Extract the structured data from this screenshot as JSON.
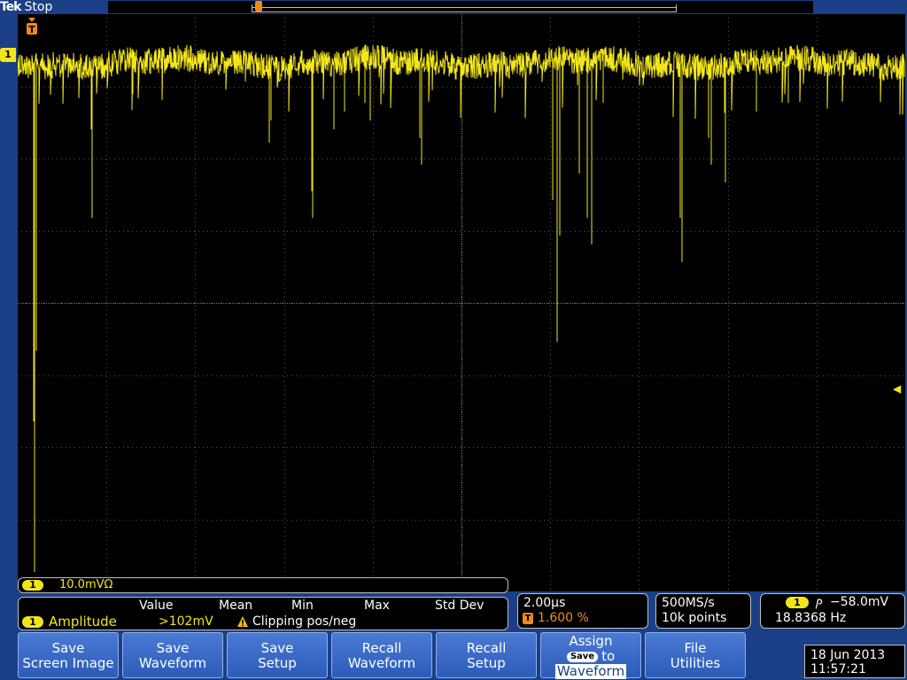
{
  "header": {
    "brand": "Tek",
    "acq_state": "Stop"
  },
  "channel": {
    "id": "1",
    "scale": "10.0mVΩ"
  },
  "measurement": {
    "columns": [
      "Value",
      "Mean",
      "Min",
      "Max",
      "Std Dev"
    ],
    "name": "Amplitude",
    "value": ">102mV",
    "warning": "Clipping pos/neg"
  },
  "timebase": {
    "scale": "2.00µs",
    "trigger_position": "1.600 %"
  },
  "acquisition": {
    "sample_rate": "500MS/s",
    "record_length": "10k points"
  },
  "trigger": {
    "edge_symbol": "ⳏ",
    "level": "−58.0mV",
    "frequency": "18.8368 Hz"
  },
  "menu": {
    "save_screen_image": [
      "Save",
      "Screen Image"
    ],
    "save_waveform": [
      "Save",
      "Waveform"
    ],
    "save_setup": [
      "Save",
      "Setup"
    ],
    "recall_waveform": [
      "Recall",
      "Waveform"
    ],
    "recall_setup": [
      "Recall",
      "Setup"
    ],
    "assign": {
      "line1": "Assign",
      "chip": "Save",
      "to": "to",
      "line3": "Waveform"
    },
    "file_utilities": [
      "File",
      "Utilities"
    ]
  },
  "datetime": {
    "date": "18 Jun 2013",
    "time": "11:57:21"
  },
  "colors": {
    "trace": "#f2e61a",
    "trigger": "#f08a1a",
    "menu_bg": "#1a3f86"
  }
}
